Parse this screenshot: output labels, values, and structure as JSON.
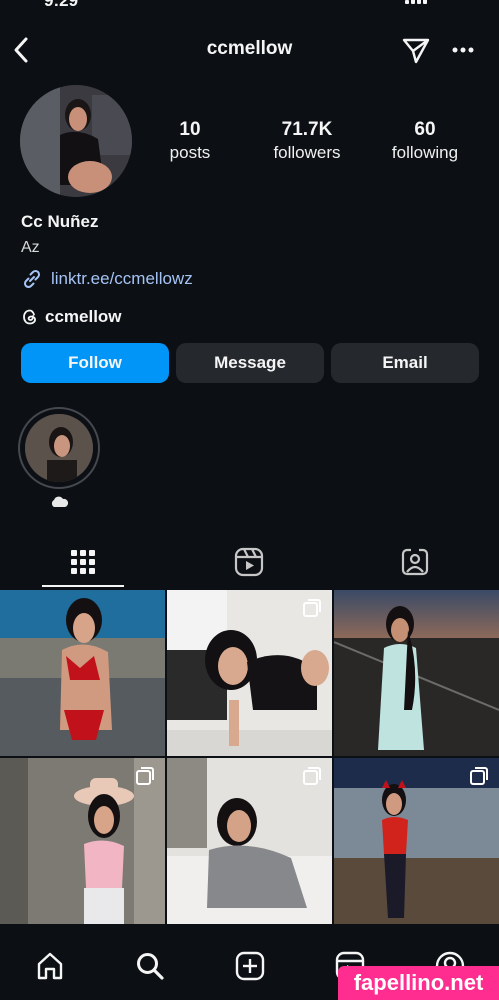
{
  "status_bar": {
    "time": "9:29"
  },
  "header": {
    "username": "ccmellow",
    "icons": [
      "back-chevron-icon",
      "send-icon",
      "more-icon"
    ]
  },
  "profile": {
    "stats": [
      {
        "value": "10",
        "label": "posts"
      },
      {
        "value": "71.7K",
        "label": "followers"
      },
      {
        "value": "60",
        "label": "following"
      }
    ],
    "display_name": "Cc Nuñez",
    "bio": "Az",
    "link": "linktr.ee/ccmellowz",
    "threads_handle": "ccmellow"
  },
  "actions": {
    "follow": "Follow",
    "message": "Message",
    "email": "Email"
  },
  "highlights": [
    {
      "icon": "cloud-icon"
    }
  ],
  "tabs": [
    "grid-icon",
    "reels-icon",
    "tagged-icon"
  ],
  "nav": [
    "home-icon",
    "search-icon",
    "create-icon",
    "reels-icon",
    "profile-icon"
  ],
  "watermark": "fapellino.net",
  "colors": {
    "background": "#0c1014",
    "follow_button": "#0095f6",
    "secondary_button": "#25292e",
    "link": "#a6c3f5"
  }
}
